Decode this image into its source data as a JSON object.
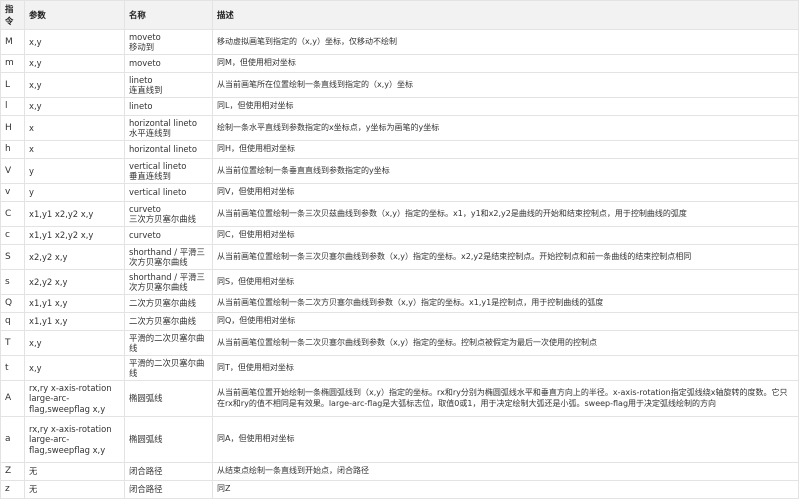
{
  "headers": [
    "指令",
    "参数",
    "名称",
    "描述"
  ],
  "rows": [
    {
      "cmd": "M",
      "params": "x,y",
      "name": [
        "moveto",
        "移动到"
      ],
      "desc": "移动虚拟画笔到指定的（x,y）坐标，仅移动不绘制",
      "h": "h22"
    },
    {
      "cmd": "m",
      "params": "x,y",
      "name": [
        "moveto"
      ],
      "desc": "同M，但使用相对坐标",
      "h": "h16"
    },
    {
      "cmd": "L",
      "params": "x,y",
      "name": [
        "lineto",
        "连直线到"
      ],
      "desc": "从当前画笔所在位置绘制一条直线到指定的（x,y）坐标",
      "h": "h22"
    },
    {
      "cmd": "l",
      "params": "x,y",
      "name": [
        "lineto"
      ],
      "desc": "同L，但使用相对坐标",
      "h": "h16"
    },
    {
      "cmd": "H",
      "params": "x",
      "name": [
        "horizontal lineto",
        "水平连线到"
      ],
      "desc": "绘制一条水平直线到参数指定的x坐标点，y坐标为画笔的y坐标",
      "h": "h22"
    },
    {
      "cmd": "h",
      "params": "x",
      "name": [
        "horizontal lineto"
      ],
      "desc": "同H，但使用相对坐标",
      "h": "h16"
    },
    {
      "cmd": "V",
      "params": "y",
      "name": [
        "vertical lineto",
        "垂直连线到"
      ],
      "desc": "从当前位置绘制一条垂直直线到参数指定的y坐标",
      "h": "h22"
    },
    {
      "cmd": "v",
      "params": "y",
      "name": [
        "vertical lineto"
      ],
      "desc": "同V，但使用相对坐标",
      "h": "h16"
    },
    {
      "cmd": "C",
      "params": "x1,y1 x2,y2 x,y",
      "name": [
        "curveto",
        "三次方贝塞尔曲线"
      ],
      "desc": "从当前画笔位置绘制一条三次贝兹曲线到参数（x,y）指定的坐标。x1，y1和x2,y2是曲线的开始和结束控制点，用于控制曲线的弧度",
      "h": "h22"
    },
    {
      "cmd": "c",
      "params": "x1,y1 x2,y2 x,y",
      "name": [
        "curveto"
      ],
      "desc": "同C，但使用相对坐标",
      "h": "h16"
    },
    {
      "cmd": "S",
      "params": "x2,y2 x,y",
      "name": [
        "shorthand / 平滑三",
        "次方贝塞尔曲线"
      ],
      "desc": "从当前画笔位置绘制一条三次贝塞尔曲线到参数（x,y）指定的坐标。x2,y2是结束控制点。开始控制点和前一条曲线的结束控制点相同",
      "h": "h22"
    },
    {
      "cmd": "s",
      "params": "x2,y2 x,y",
      "name": [
        "shorthand / 平滑三",
        "次方贝塞尔曲线"
      ],
      "desc": "同S，但使用相对坐标",
      "h": "h22"
    },
    {
      "cmd": "Q",
      "params": "x1,y1 x,y",
      "name": [
        "二次方贝塞尔曲线"
      ],
      "desc": "从当前画笔位置绘制一条二次方贝塞尔曲线到参数（x,y）指定的坐标。x1,y1是控制点，用于控制曲线的弧度",
      "h": "h16"
    },
    {
      "cmd": "q",
      "params": "x1,y1 x,y",
      "name": [
        "二次方贝塞尔曲线"
      ],
      "desc": "同Q，但使用相对坐标",
      "h": "h16"
    },
    {
      "cmd": "T",
      "params": "x,y",
      "name": [
        "平滑的二次贝塞尔曲",
        "线"
      ],
      "desc": "从当前画笔位置绘制一条二次贝塞尔曲线到参数（x,y）指定的坐标。控制点被假定为最后一次使用的控制点",
      "h": "h22"
    },
    {
      "cmd": "t",
      "params": "x,y",
      "name": [
        "平滑的二次贝塞尔曲线"
      ],
      "desc": "同T，但使用相对坐标",
      "h": "h22"
    },
    {
      "cmd": "A",
      "params": "rx,ry x-axis-rotation large-arc-flag,sweepflag x,y",
      "name": [
        "椭圆弧线"
      ],
      "desc": "从当前画笔位置开始绘制一条椭圆弧线到（x,y）指定的坐标。rx和ry分别为椭圆弧线水平和垂直方向上的半径。x-axis-rotation指定弧线绕x轴旋转的度数。它只在rx和ry的值不相同是有效果。large-arc-flag是大弧标志位，取值0或1，用于决定绘制大弧还是小弧。sweep-flag用于决定弧线绘制的方向",
      "h": "h33"
    },
    {
      "cmd": "a",
      "params": "rx,ry x-axis-rotation large-arc-flag,sweepflag x,y",
      "name": [
        "椭圆弧线"
      ],
      "desc": "同A，但使用相对坐标",
      "h": "h43"
    },
    {
      "cmd": "Z",
      "params": "无",
      "name": [
        "闭合路径"
      ],
      "desc": "从结束点绘制一条直线到开始点，闭合路径",
      "h": "h16"
    },
    {
      "cmd": "z",
      "params": "无",
      "name": [
        "闭合路径"
      ],
      "desc": "同Z",
      "h": "h16"
    }
  ]
}
